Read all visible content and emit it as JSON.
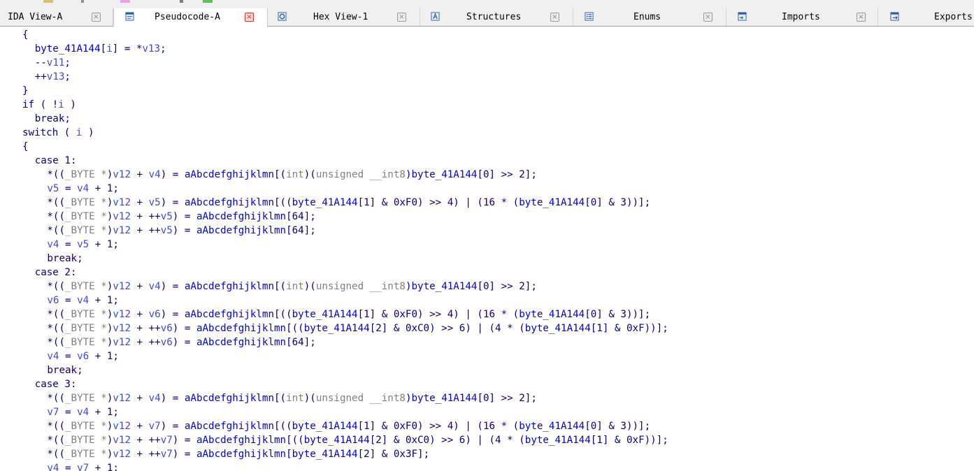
{
  "window": {
    "tabs": [
      {
        "label": "IDA View-A",
        "icon": "none",
        "active": false
      },
      {
        "label": "Pseudocode-A",
        "icon": "pseudocode-icon",
        "active": true
      },
      {
        "label": "Hex View-1",
        "icon": "hex-view-icon",
        "active": false
      },
      {
        "label": "Structures",
        "icon": "structures-icon",
        "active": false
      },
      {
        "label": "Enums",
        "icon": "enums-icon",
        "active": false
      },
      {
        "label": "Imports",
        "icon": "imports-icon",
        "active": false
      },
      {
        "label": "Exports",
        "icon": "exports-icon",
        "active": false
      }
    ],
    "close_glyph": "×"
  },
  "colors": {
    "keyword": "#000080",
    "variable": "#3b4bd0",
    "type": "#808080",
    "identifier": "#0000c8",
    "active_close": "#d0342c"
  },
  "code": {
    "lines": [
      {
        "indent": 2,
        "tokens": [
          [
            "def",
            "{"
          ]
        ]
      },
      {
        "indent": 3,
        "tokens": [
          [
            "id",
            "byte_41A144"
          ],
          [
            "def",
            "["
          ],
          [
            "var",
            "i"
          ],
          [
            "def",
            "] = *"
          ],
          [
            "var",
            "v13"
          ],
          [
            "def",
            ";"
          ]
        ]
      },
      {
        "indent": 3,
        "tokens": [
          [
            "def",
            "--"
          ],
          [
            "var",
            "v11"
          ],
          [
            "def",
            ";"
          ]
        ]
      },
      {
        "indent": 3,
        "tokens": [
          [
            "def",
            "++"
          ],
          [
            "var",
            "v13"
          ],
          [
            "def",
            ";"
          ]
        ]
      },
      {
        "indent": 2,
        "tokens": [
          [
            "def",
            "}"
          ]
        ]
      },
      {
        "indent": 2,
        "tokens": [
          [
            "kw",
            "if"
          ],
          [
            "def",
            " ( !"
          ],
          [
            "var",
            "i"
          ],
          [
            "def",
            " )"
          ]
        ]
      },
      {
        "indent": 3,
        "tokens": [
          [
            "kw",
            "break"
          ],
          [
            "def",
            ";"
          ]
        ]
      },
      {
        "indent": 2,
        "tokens": [
          [
            "kw",
            "switch"
          ],
          [
            "def",
            " ( "
          ],
          [
            "var",
            "i"
          ],
          [
            "def",
            " )"
          ]
        ]
      },
      {
        "indent": 2,
        "tokens": [
          [
            "def",
            "{"
          ]
        ]
      },
      {
        "indent": 3,
        "tokens": [
          [
            "kw",
            "case"
          ],
          [
            "def",
            " 1:"
          ]
        ]
      },
      {
        "indent": 4,
        "tokens": [
          [
            "def",
            "*(("
          ],
          [
            "typ",
            "_BYTE *"
          ],
          [
            "def",
            ")"
          ],
          [
            "var",
            "v12"
          ],
          [
            "def",
            " + "
          ],
          [
            "var",
            "v4"
          ],
          [
            "def",
            ") = "
          ],
          [
            "id",
            "aAbcdefghijklmn"
          ],
          [
            "def",
            "[("
          ],
          [
            "typ",
            "int"
          ],
          [
            "def",
            ")("
          ],
          [
            "typ",
            "unsigned __int8"
          ],
          [
            "def",
            ")"
          ],
          [
            "id",
            "byte_41A144"
          ],
          [
            "def",
            "[0] >> 2];"
          ]
        ]
      },
      {
        "indent": 4,
        "tokens": [
          [
            "var",
            "v5"
          ],
          [
            "def",
            " = "
          ],
          [
            "var",
            "v4"
          ],
          [
            "def",
            " + 1;"
          ]
        ]
      },
      {
        "indent": 4,
        "tokens": [
          [
            "def",
            "*(("
          ],
          [
            "typ",
            "_BYTE *"
          ],
          [
            "def",
            ")"
          ],
          [
            "var",
            "v12"
          ],
          [
            "def",
            " + "
          ],
          [
            "var",
            "v5"
          ],
          [
            "def",
            ") = "
          ],
          [
            "id",
            "aAbcdefghijklmn"
          ],
          [
            "def",
            "[(("
          ],
          [
            "id",
            "byte_41A144"
          ],
          [
            "def",
            "[1] & 0xF0) >> 4) | (16 * ("
          ],
          [
            "id",
            "byte_41A144"
          ],
          [
            "def",
            "[0] & 3))];"
          ]
        ]
      },
      {
        "indent": 4,
        "tokens": [
          [
            "def",
            "*(("
          ],
          [
            "typ",
            "_BYTE *"
          ],
          [
            "def",
            ")"
          ],
          [
            "var",
            "v12"
          ],
          [
            "def",
            " + ++"
          ],
          [
            "var",
            "v5"
          ],
          [
            "def",
            ") = "
          ],
          [
            "id",
            "aAbcdefghijklmn"
          ],
          [
            "def",
            "[64];"
          ]
        ]
      },
      {
        "indent": 4,
        "tokens": [
          [
            "def",
            "*(("
          ],
          [
            "typ",
            "_BYTE *"
          ],
          [
            "def",
            ")"
          ],
          [
            "var",
            "v12"
          ],
          [
            "def",
            " + ++"
          ],
          [
            "var",
            "v5"
          ],
          [
            "def",
            ") = "
          ],
          [
            "id",
            "aAbcdefghijklmn"
          ],
          [
            "def",
            "[64];"
          ]
        ]
      },
      {
        "indent": 4,
        "tokens": [
          [
            "var",
            "v4"
          ],
          [
            "def",
            " = "
          ],
          [
            "var",
            "v5"
          ],
          [
            "def",
            " + 1;"
          ]
        ]
      },
      {
        "indent": 4,
        "tokens": [
          [
            "kw",
            "break"
          ],
          [
            "def",
            ";"
          ]
        ]
      },
      {
        "indent": 3,
        "tokens": [
          [
            "kw",
            "case"
          ],
          [
            "def",
            " 2:"
          ]
        ]
      },
      {
        "indent": 4,
        "tokens": [
          [
            "def",
            "*(("
          ],
          [
            "typ",
            "_BYTE *"
          ],
          [
            "def",
            ")"
          ],
          [
            "var",
            "v12"
          ],
          [
            "def",
            " + "
          ],
          [
            "var",
            "v4"
          ],
          [
            "def",
            ") = "
          ],
          [
            "id",
            "aAbcdefghijklmn"
          ],
          [
            "def",
            "[("
          ],
          [
            "typ",
            "int"
          ],
          [
            "def",
            ")("
          ],
          [
            "typ",
            "unsigned __int8"
          ],
          [
            "def",
            ")"
          ],
          [
            "id",
            "byte_41A144"
          ],
          [
            "def",
            "[0] >> 2];"
          ]
        ]
      },
      {
        "indent": 4,
        "tokens": [
          [
            "var",
            "v6"
          ],
          [
            "def",
            " = "
          ],
          [
            "var",
            "v4"
          ],
          [
            "def",
            " + 1;"
          ]
        ]
      },
      {
        "indent": 4,
        "tokens": [
          [
            "def",
            "*(("
          ],
          [
            "typ",
            "_BYTE *"
          ],
          [
            "def",
            ")"
          ],
          [
            "var",
            "v12"
          ],
          [
            "def",
            " + "
          ],
          [
            "var",
            "v6"
          ],
          [
            "def",
            ") = "
          ],
          [
            "id",
            "aAbcdefghijklmn"
          ],
          [
            "def",
            "[(("
          ],
          [
            "id",
            "byte_41A144"
          ],
          [
            "def",
            "[1] & 0xF0) >> 4) | (16 * ("
          ],
          [
            "id",
            "byte_41A144"
          ],
          [
            "def",
            "[0] & 3))];"
          ]
        ]
      },
      {
        "indent": 4,
        "tokens": [
          [
            "def",
            "*(("
          ],
          [
            "typ",
            "_BYTE *"
          ],
          [
            "def",
            ")"
          ],
          [
            "var",
            "v12"
          ],
          [
            "def",
            " + ++"
          ],
          [
            "var",
            "v6"
          ],
          [
            "def",
            ") = "
          ],
          [
            "id",
            "aAbcdefghijklmn"
          ],
          [
            "def",
            "[(("
          ],
          [
            "id",
            "byte_41A144"
          ],
          [
            "def",
            "[2] & 0xC0) >> 6) | (4 * ("
          ],
          [
            "id",
            "byte_41A144"
          ],
          [
            "def",
            "[1] & 0xF))];"
          ]
        ]
      },
      {
        "indent": 4,
        "tokens": [
          [
            "def",
            "*(("
          ],
          [
            "typ",
            "_BYTE *"
          ],
          [
            "def",
            ")"
          ],
          [
            "var",
            "v12"
          ],
          [
            "def",
            " + ++"
          ],
          [
            "var",
            "v6"
          ],
          [
            "def",
            ") = "
          ],
          [
            "id",
            "aAbcdefghijklmn"
          ],
          [
            "def",
            "[64];"
          ]
        ]
      },
      {
        "indent": 4,
        "tokens": [
          [
            "var",
            "v4"
          ],
          [
            "def",
            " = "
          ],
          [
            "var",
            "v6"
          ],
          [
            "def",
            " + 1;"
          ]
        ]
      },
      {
        "indent": 4,
        "tokens": [
          [
            "kw",
            "break"
          ],
          [
            "def",
            ";"
          ]
        ]
      },
      {
        "indent": 3,
        "tokens": [
          [
            "kw",
            "case"
          ],
          [
            "def",
            " 3:"
          ]
        ]
      },
      {
        "indent": 4,
        "tokens": [
          [
            "def",
            "*(("
          ],
          [
            "typ",
            "_BYTE *"
          ],
          [
            "def",
            ")"
          ],
          [
            "var",
            "v12"
          ],
          [
            "def",
            " + "
          ],
          [
            "var",
            "v4"
          ],
          [
            "def",
            ") = "
          ],
          [
            "id",
            "aAbcdefghijklmn"
          ],
          [
            "def",
            "[("
          ],
          [
            "typ",
            "int"
          ],
          [
            "def",
            ")("
          ],
          [
            "typ",
            "unsigned __int8"
          ],
          [
            "def",
            ")"
          ],
          [
            "id",
            "byte_41A144"
          ],
          [
            "def",
            "[0] >> 2];"
          ]
        ]
      },
      {
        "indent": 4,
        "tokens": [
          [
            "var",
            "v7"
          ],
          [
            "def",
            " = "
          ],
          [
            "var",
            "v4"
          ],
          [
            "def",
            " + 1;"
          ]
        ]
      },
      {
        "indent": 4,
        "tokens": [
          [
            "def",
            "*(("
          ],
          [
            "typ",
            "_BYTE *"
          ],
          [
            "def",
            ")"
          ],
          [
            "var",
            "v12"
          ],
          [
            "def",
            " + "
          ],
          [
            "var",
            "v7"
          ],
          [
            "def",
            ") = "
          ],
          [
            "id",
            "aAbcdefghijklmn"
          ],
          [
            "def",
            "[(("
          ],
          [
            "id",
            "byte_41A144"
          ],
          [
            "def",
            "[1] & 0xF0) >> 4) | (16 * ("
          ],
          [
            "id",
            "byte_41A144"
          ],
          [
            "def",
            "[0] & 3))];"
          ]
        ]
      },
      {
        "indent": 4,
        "tokens": [
          [
            "def",
            "*(("
          ],
          [
            "typ",
            "_BYTE *"
          ],
          [
            "def",
            ")"
          ],
          [
            "var",
            "v12"
          ],
          [
            "def",
            " + ++"
          ],
          [
            "var",
            "v7"
          ],
          [
            "def",
            ") = "
          ],
          [
            "id",
            "aAbcdefghijklmn"
          ],
          [
            "def",
            "[(("
          ],
          [
            "id",
            "byte_41A144"
          ],
          [
            "def",
            "[2] & 0xC0) >> 6) | (4 * ("
          ],
          [
            "id",
            "byte_41A144"
          ],
          [
            "def",
            "[1] & 0xF))];"
          ]
        ]
      },
      {
        "indent": 4,
        "tokens": [
          [
            "def",
            "*(("
          ],
          [
            "typ",
            "_BYTE *"
          ],
          [
            "def",
            ")"
          ],
          [
            "var",
            "v12"
          ],
          [
            "def",
            " + ++"
          ],
          [
            "var",
            "v7"
          ],
          [
            "def",
            ") = "
          ],
          [
            "id",
            "aAbcdefghijklmn"
          ],
          [
            "def",
            "["
          ],
          [
            "id",
            "byte_41A144"
          ],
          [
            "def",
            "[2] & 0x3F];"
          ]
        ]
      },
      {
        "indent": 4,
        "tokens": [
          [
            "var",
            "v4"
          ],
          [
            "def",
            " = "
          ],
          [
            "var",
            "v7"
          ],
          [
            "def",
            " + 1;"
          ]
        ]
      }
    ]
  }
}
